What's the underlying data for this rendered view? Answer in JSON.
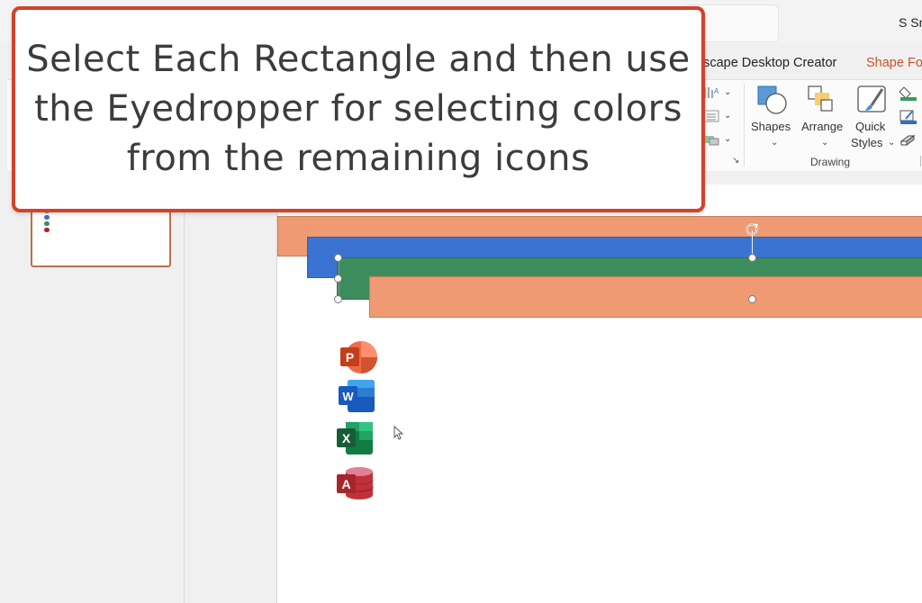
{
  "titlebar": {
    "user_label": "S Sm"
  },
  "ribbon": {
    "tabs": [
      {
        "label": "escape Desktop Creator",
        "active": false
      },
      {
        "label": "Shape Fo",
        "active": true,
        "color": "#c4562a"
      }
    ],
    "groups": {
      "drawing": {
        "label": "Drawing",
        "buttons": [
          {
            "label": "Shapes"
          },
          {
            "label": "Arrange"
          },
          {
            "label_line1": "Quick",
            "label_line2": "Styles"
          }
        ]
      }
    },
    "small_icons": [
      "text-direction-icon",
      "align-text-icon",
      "convert-smartart-icon",
      "shape-fill-icon",
      "shape-outline-icon",
      "shape-effects-icon"
    ]
  },
  "callout": {
    "text": "Select Each Rectangle and then use the Eyedropper for selecting colors from the remaining icons",
    "border_color": "#d2432b"
  },
  "slide": {
    "rectangles": [
      {
        "name": "orange-rectangle-top",
        "color": "#ef9a72"
      },
      {
        "name": "blue-rectangle",
        "color": "#3a73d1"
      },
      {
        "name": "green-rectangle",
        "color": "#3d8c5e",
        "selected": true
      },
      {
        "name": "orange-rectangle-bottom",
        "color": "#ef9a72"
      }
    ],
    "app_icons": [
      {
        "name": "powerpoint",
        "letter": "P",
        "color": "#c4462a"
      },
      {
        "name": "word",
        "letter": "W",
        "color": "#2b5cb8"
      },
      {
        "name": "excel",
        "letter": "X",
        "color": "#1e7145"
      },
      {
        "name": "access",
        "letter": "A",
        "color": "#a4262c"
      }
    ]
  },
  "thumbnail": {
    "dot_colors": [
      "#d27a50",
      "#3a73d1",
      "#3d8c5e",
      "#a4262c"
    ]
  }
}
